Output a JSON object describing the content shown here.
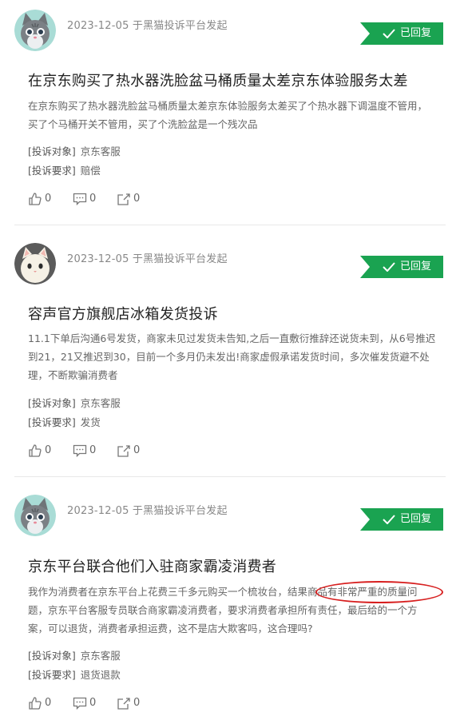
{
  "colors": {
    "badge_green": "#1aa351",
    "annotation_red": "#d71f1f"
  },
  "complaints": [
    {
      "avatar": "gray-cat-avatar",
      "meta": "2023-12-05 于黑猫投诉平台发起",
      "status": "已回复",
      "title": "在京东购买了热水器洗脸盆马桶质量太差京东体验服务太差",
      "body": "在京东购买了热水器洗脸盆马桶质量太差京东体验服务太差买了个热水器下调温度不管用，买了个马桶开关不管用，买了个洗脸盆是一个残次品",
      "target_label": "[投诉对象]",
      "target_value": "京东客服",
      "demand_label": "[投诉要求]",
      "demand_value": "赔偿",
      "likes": "0",
      "comments": "0",
      "shares": "0"
    },
    {
      "avatar": "white-cat-avatar",
      "meta": "2023-12-05 于黑猫投诉平台发起",
      "status": "已回复",
      "title": "容声官方旗舰店冰箱发货投诉",
      "body": "11.1下单后沟通6号发货，商家未见过发货未告知,之后一直敷衍推辞还说货未到，从6号推迟到21，21又推迟到30，目前一个多月仍未发出!商家虚假承诺发货时间，多次催发货避不处理，不断欺骗消费者",
      "target_label": "[投诉对象]",
      "target_value": "京东客服",
      "demand_label": "[投诉要求]",
      "demand_value": "发货",
      "likes": "0",
      "comments": "0",
      "shares": "0"
    },
    {
      "avatar": "gray-cat-avatar",
      "meta": "2023-12-05 于黑猫投诉平台发起",
      "status": "已回复",
      "title": "京东平台联合他们入驻商家霸凌消费者",
      "body": "我作为消费者在京东平台上花费三千多元购买一个梳妆台，结果商品有非常严重的质量问题，京东平台客服专员联合商家霸凌消费者，要求消费者承担所有责任，最后给的一个方案，可以退货，消费者承担运费，这不是店大欺客吗，这合理吗?",
      "target_label": "[投诉对象]",
      "target_value": "京东客服",
      "demand_label": "[投诉要求]",
      "demand_value": "退货退款",
      "likes": "0",
      "comments": "0",
      "shares": "0"
    }
  ]
}
